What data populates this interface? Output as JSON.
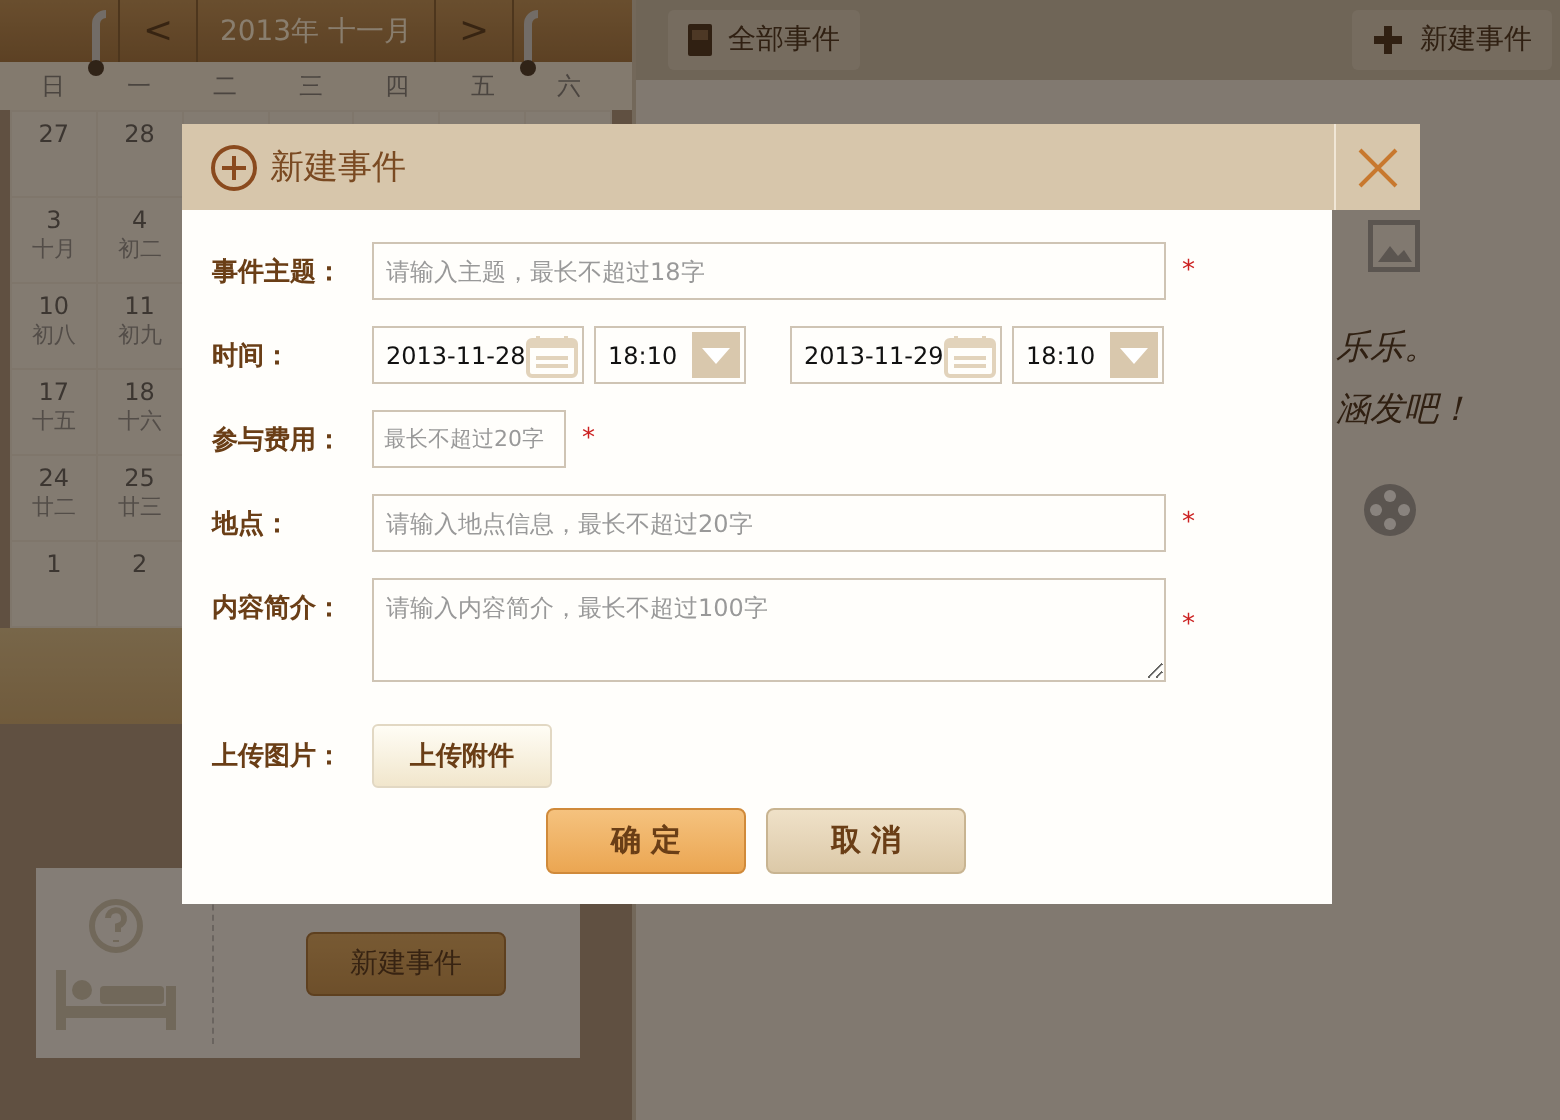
{
  "calendar": {
    "prev": "<",
    "month": "2013年  十一月",
    "next": ">",
    "weekdays": [
      "日",
      "一",
      "二",
      "三",
      "四",
      "五",
      "六"
    ],
    "weeks": [
      [
        {
          "day": "27"
        },
        {
          "day": "28"
        }
      ],
      [
        {
          "day": "3",
          "lunar": "十月"
        },
        {
          "day": "4",
          "lunar": "初二"
        }
      ],
      [
        {
          "day": "10",
          "lunar": "初八"
        },
        {
          "day": "11",
          "lunar": "初九"
        }
      ],
      [
        {
          "day": "17",
          "lunar": "十五"
        },
        {
          "day": "18",
          "lunar": "十六"
        }
      ],
      [
        {
          "day": "24",
          "lunar": "廿二"
        },
        {
          "day": "25",
          "lunar": "廿三"
        }
      ],
      [
        {
          "day": "1"
        },
        {
          "day": "2"
        }
      ]
    ]
  },
  "empty_card": {
    "button": "新建事件"
  },
  "toolbar": {
    "all_events": "全部事件",
    "new_event": "新建事件"
  },
  "background_note": [
    "乐乐。",
    "涵发吧！"
  ],
  "dialog": {
    "title": "新建事件",
    "subject": {
      "label": "事件主题：",
      "placeholder": "请输入主题，最长不超过18字",
      "required_mark": "*"
    },
    "time": {
      "label": "时间：",
      "start_date": "2013-11-28",
      "start_time": "18:10",
      "end_date": "2013-11-29",
      "end_time": "18:10"
    },
    "fee": {
      "label": "参与费用：",
      "placeholder": "最长不超过20字",
      "required_mark": "*"
    },
    "location": {
      "label": "地点：",
      "placeholder": "请输入地点信息，最长不超过20字",
      "required_mark": "*"
    },
    "summary": {
      "label": "内容简介：",
      "placeholder": "请输入内容简介，最长不超过100字",
      "required_mark": "*"
    },
    "upload": {
      "label": "上传图片：",
      "button": "上传附件"
    },
    "buttons": [
      {
        "label": "确 定",
        "kind": "primary"
      },
      {
        "label": "取 消",
        "kind": "secondary"
      }
    ]
  }
}
